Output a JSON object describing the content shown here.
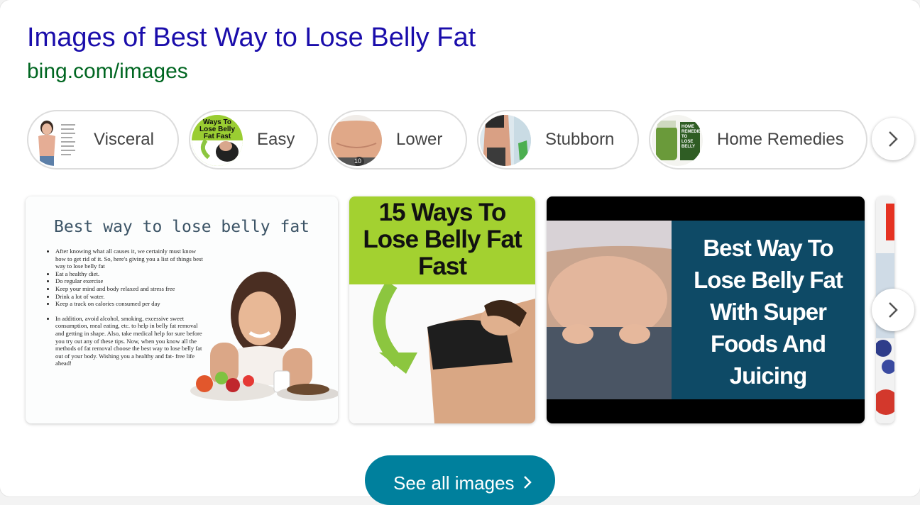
{
  "header": {
    "title": "Images of Best Way to Lose Belly Fat",
    "url": "bing.com/images"
  },
  "chips": [
    {
      "label": "Visceral"
    },
    {
      "label": "Easy",
      "thumb_text": "Ways To Lose Belly Fat Fast"
    },
    {
      "label": "Lower",
      "thumb_badge": "10"
    },
    {
      "label": "Stubborn"
    },
    {
      "label": "Home Remedies",
      "thumb_text": "HOME REMEDIES TO LOSE BELLY"
    }
  ],
  "images": {
    "tile1": {
      "heading": "Best way to lose belly fat",
      "bullets": [
        "After knowing what all causes it, we certainly must know how to get rid of it. So, here's giving you a list of things best way to lose belly fat",
        "Eat a healthy diet.",
        "Do regular exercise",
        "Keep your mind and body relaxed and stress free",
        "Drink a lot of water.",
        "Keep a track on calories consumed per day",
        "In addition, avoid alcohol, smoking, excessive sweet consumption, meal eating, etc. to help in belly fat removal and getting in shape. Also, take medical help for sure before you try out any of these tips. Now, when you know all the methods of fat removal choose the best way to lose belly fat out of your body. Wishing you a healthy and fat- free life ahead!"
      ]
    },
    "tile2": {
      "line1": "15 Ways To",
      "line2": "Lose Belly Fat",
      "line3": "Fast"
    },
    "tile3": {
      "line1": "Best Way To",
      "line2": "Lose Belly Fat",
      "line3": "With Super",
      "line4": "Foods And",
      "line5": "Juicing"
    }
  },
  "see_all": {
    "label": "See all images"
  },
  "icons": {
    "chips_next": "chevron-right-icon",
    "images_next": "chevron-right-icon"
  },
  "colors": {
    "title": "#1a0dab",
    "url": "#006621",
    "see_all_bg": "#00809d",
    "lime": "#9acd32",
    "navy": "#0e4a66"
  }
}
